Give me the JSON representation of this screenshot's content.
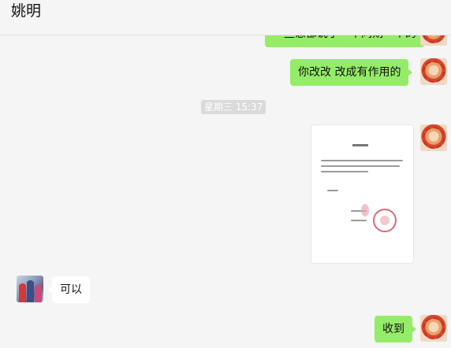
{
  "header": {
    "title": "姚明",
    "more": "···"
  },
  "messages": {
    "m1": "一些意都说了一个同期一个的",
    "m2": "你改改  改成有作用的",
    "timestamp": "星期三 15:37",
    "m4": "可以",
    "m5": "收到"
  },
  "colors": {
    "bubble_me": "#95ec69",
    "bubble_other": "#ffffff",
    "background": "#f5f5f5"
  }
}
